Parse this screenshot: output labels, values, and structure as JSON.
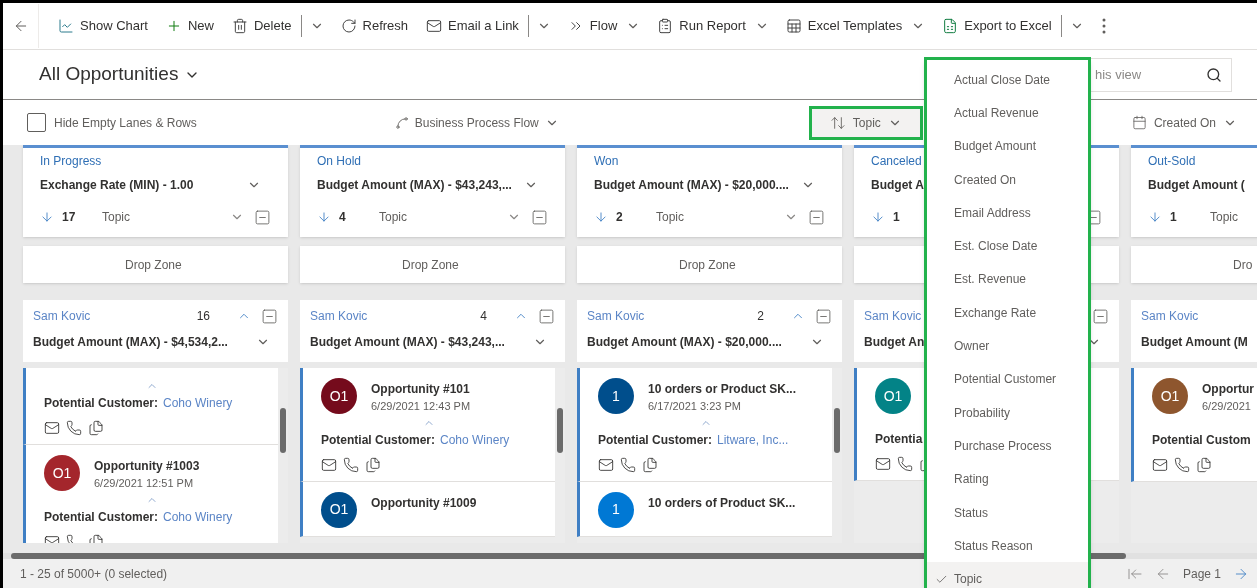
{
  "toolbar": {
    "items": [
      {
        "label": "Show Chart",
        "kind": "plain"
      },
      {
        "label": "New",
        "kind": "plain"
      },
      {
        "label": "Delete",
        "kind": "split"
      },
      {
        "label": "Refresh",
        "kind": "plain"
      },
      {
        "label": "Email a Link",
        "kind": "split"
      },
      {
        "label": "Flow",
        "kind": "dropdown"
      },
      {
        "label": "Run Report",
        "kind": "dropdown"
      },
      {
        "label": "Excel Templates",
        "kind": "dropdown"
      },
      {
        "label": "Export to Excel",
        "kind": "split"
      }
    ]
  },
  "view": {
    "title": "All Opportunities",
    "search": {
      "placeholder": "his view"
    }
  },
  "filters": {
    "hide_empty": {
      "label": "Hide Empty Lanes & Rows",
      "checked": false
    },
    "process": "Business Process Flow",
    "sort": {
      "label": "Topic",
      "highlighted": true
    },
    "date": "Created On"
  },
  "lanes": [
    {
      "title": "In Progress",
      "aggregate": "Exchange Rate (MIN) - 1.00",
      "count": "17",
      "sort_field": "Topic",
      "drop_zone": "Drop Zone",
      "group": {
        "name": "Sam Kovic",
        "count": "16",
        "aggregate": "Budget Amount (MAX) - $4,534,2...",
        "cards": [
          {
            "customer_label": "Potential Customer:",
            "customer": "Coho Winery"
          },
          {
            "avatar": "O1",
            "color": "#a4262c",
            "title": "Opportunity #1003",
            "date": "6/29/2021 12:51 PM",
            "customer_label": "Potential Customer:",
            "customer": "Coho Winery"
          }
        ]
      }
    },
    {
      "title": "On Hold",
      "aggregate": "Budget Amount (MAX) - $43,243,...",
      "count": "4",
      "sort_field": "Topic",
      "drop_zone": "Drop Zone",
      "group": {
        "name": "Sam Kovic",
        "count": "4",
        "aggregate": "Budget Amount (MAX) - $43,243,...",
        "cards": [
          {
            "avatar": "O1",
            "color": "#750b1c",
            "title": "Opportunity #101",
            "date": "6/29/2021 12:43 PM",
            "customer_label": "Potential Customer:",
            "customer": "Coho Winery"
          },
          {
            "avatar": "O1",
            "color": "#004e8c",
            "title": "Opportunity #1009"
          }
        ]
      }
    },
    {
      "title": "Won",
      "aggregate": "Budget Amount (MAX) - $20,000....",
      "count": "2",
      "sort_field": "Topic",
      "drop_zone": "Drop Zone",
      "group": {
        "name": "Sam Kovic",
        "count": "2",
        "aggregate": "Budget Amount (MAX) - $20,000....",
        "cards": [
          {
            "avatar": "1",
            "color": "#004e8c",
            "title": "10 orders or Product SK...",
            "date": "6/17/2021 3:23 PM",
            "customer_label": "Potential Customer:",
            "customer": "Litware, Inc..."
          },
          {
            "avatar": "1",
            "color": "#0078d4",
            "title": "10 orders of Product SK..."
          }
        ]
      }
    },
    {
      "title": "Canceled",
      "aggregate": "Budget A",
      "count": "1",
      "group": {
        "name": "Sam Kovic",
        "aggregate": "Budget An",
        "cards": [
          {
            "avatar": "O1",
            "color": "#038387",
            "customer_label": "Potentia"
          }
        ]
      }
    },
    {
      "title": "Out-Sold",
      "aggregate": "Budget Amount (",
      "count": "1",
      "sort_field": "Topic",
      "drop_zone": "Dro",
      "group": {
        "name": "Sam Kovic",
        "aggregate": "Budget Amount (M",
        "cards": [
          {
            "avatar": "O1",
            "color": "#8e562e",
            "title": "Opportur",
            "date": "6/29/2021",
            "customer_label": "Potential Custom"
          }
        ]
      }
    }
  ],
  "sort_menu": {
    "items": [
      {
        "label": "Actual Close Date",
        "selected": false
      },
      {
        "label": "Actual Revenue",
        "selected": false
      },
      {
        "label": "Budget Amount",
        "selected": false
      },
      {
        "label": "Created On",
        "selected": false
      },
      {
        "label": "Email Address",
        "selected": false
      },
      {
        "label": "Est. Close Date",
        "selected": false
      },
      {
        "label": "Est. Revenue",
        "selected": false
      },
      {
        "label": "Exchange Rate",
        "selected": false
      },
      {
        "label": "Owner",
        "selected": false
      },
      {
        "label": "Potential Customer",
        "selected": false
      },
      {
        "label": "Probability",
        "selected": false
      },
      {
        "label": "Purchase Process",
        "selected": false
      },
      {
        "label": "Rating",
        "selected": false
      },
      {
        "label": "Status",
        "selected": false
      },
      {
        "label": "Status Reason",
        "selected": false
      },
      {
        "label": "Topic",
        "selected": true
      }
    ]
  },
  "status_bar": {
    "summary": "1 - 25 of 5000+ (0 selected)",
    "page": "Page 1"
  }
}
